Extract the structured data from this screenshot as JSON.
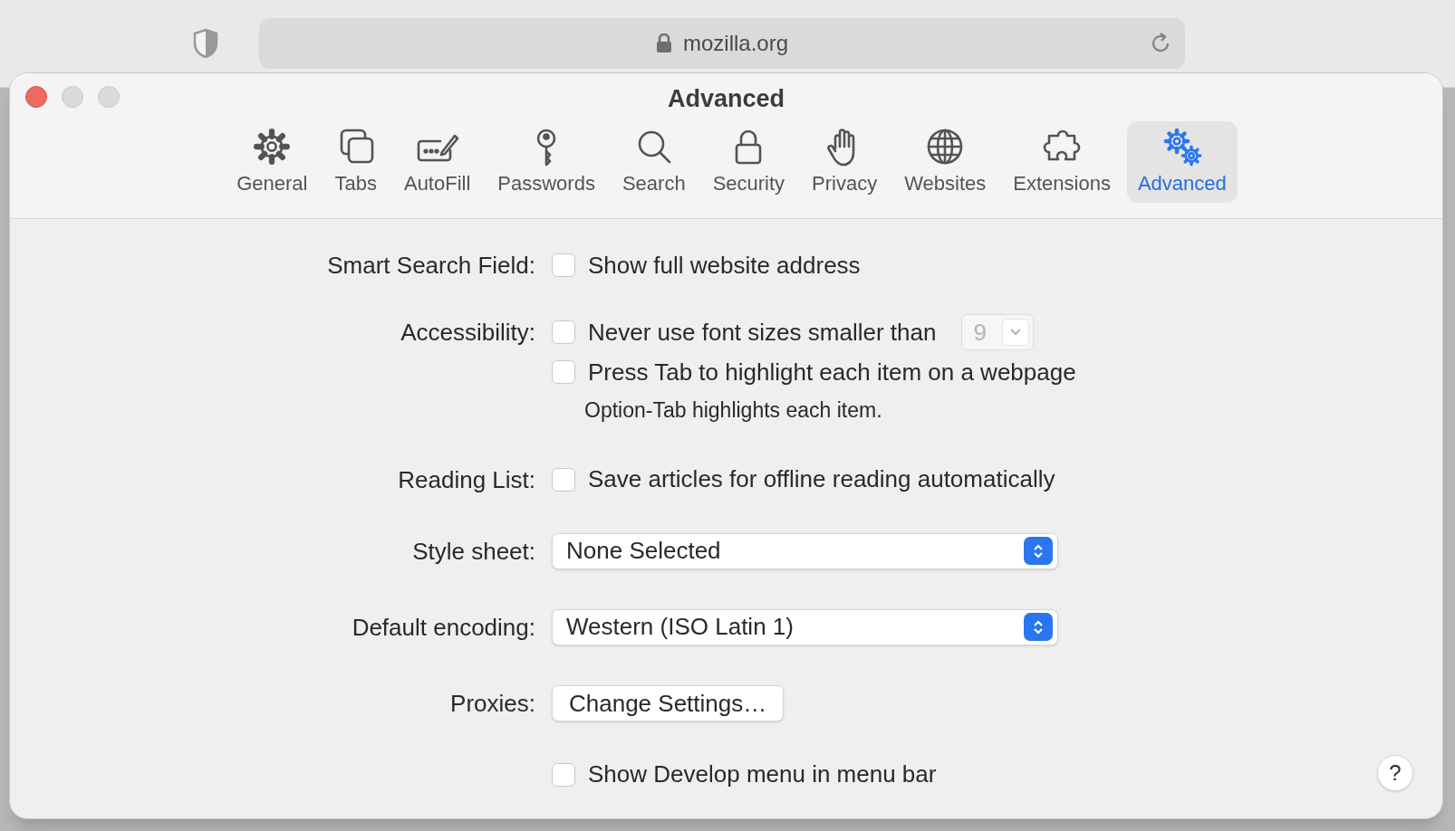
{
  "browser": {
    "address": "mozilla.org"
  },
  "window": {
    "title": "Advanced"
  },
  "toolbar": [
    {
      "kind": "gear",
      "label": "General",
      "selected": false
    },
    {
      "kind": "tabs",
      "label": "Tabs",
      "selected": false
    },
    {
      "kind": "autofill",
      "label": "AutoFill",
      "selected": false
    },
    {
      "kind": "key",
      "label": "Passwords",
      "selected": false
    },
    {
      "kind": "search",
      "label": "Search",
      "selected": false
    },
    {
      "kind": "lock",
      "label": "Security",
      "selected": false
    },
    {
      "kind": "hand",
      "label": "Privacy",
      "selected": false
    },
    {
      "kind": "globe",
      "label": "Websites",
      "selected": false
    },
    {
      "kind": "puzzle",
      "label": "Extensions",
      "selected": false
    },
    {
      "kind": "gears",
      "label": "Advanced",
      "selected": true
    }
  ],
  "settings": [
    {
      "kind": "checks",
      "label": "Smart Search Field:",
      "options": [
        {
          "label": "Show full website address",
          "checked": false
        }
      ]
    },
    {
      "kind": "checks",
      "label": "Accessibility:",
      "options": [
        {
          "label": "Never use font sizes smaller than",
          "checked": false,
          "font_size": "9"
        },
        {
          "label": "Press Tab to highlight each item on a webpage",
          "checked": false,
          "hint": "Option-Tab highlights each item."
        }
      ]
    },
    {
      "kind": "checks",
      "label": "Reading List:",
      "options": [
        {
          "label": "Save articles for offline reading automatically",
          "checked": false
        }
      ]
    },
    {
      "kind": "select",
      "label": "Style sheet:",
      "value": "None Selected"
    },
    {
      "kind": "select",
      "label": "Default encoding:",
      "value": "Western (ISO Latin 1)"
    },
    {
      "kind": "button",
      "label": "Proxies:",
      "value": "Change Settings…"
    },
    {
      "kind": "checks",
      "options": [
        {
          "label": "Show Develop menu in menu bar",
          "checked": false
        }
      ]
    }
  ],
  "help": "?"
}
